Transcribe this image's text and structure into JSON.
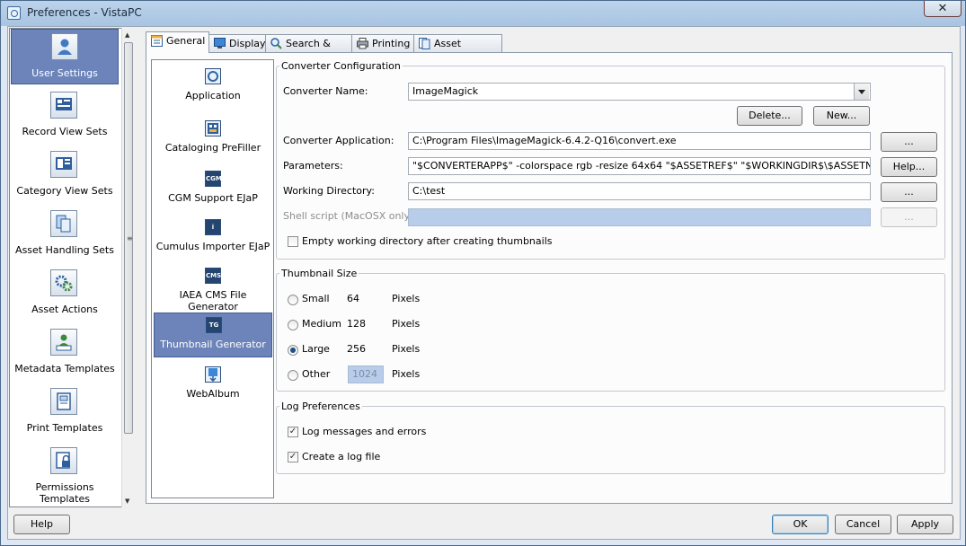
{
  "window": {
    "title": "Preferences - VistaPC",
    "close_glyph": "✕"
  },
  "sidebar": {
    "items": [
      {
        "label": "User Settings",
        "icon": "user-icon",
        "selected": true
      },
      {
        "label": "Record View Sets",
        "icon": "record-view-icon"
      },
      {
        "label": "Category View Sets",
        "icon": "category-view-icon"
      },
      {
        "label": "Asset Handling Sets",
        "icon": "asset-handling-icon"
      },
      {
        "label": "Asset Actions",
        "icon": "gears-icon"
      },
      {
        "label": "Metadata Templates",
        "icon": "metadata-icon"
      },
      {
        "label": "Print Templates",
        "icon": "print-template-icon"
      },
      {
        "label": "Permissions Templates",
        "icon": "lock-icon"
      }
    ]
  },
  "tabs": [
    {
      "label": "General",
      "icon": "general-icon",
      "active": true
    },
    {
      "label": "Display",
      "icon": "monitor-icon"
    },
    {
      "label": "Search & Sort",
      "icon": "magnifier-icon"
    },
    {
      "label": "Printing",
      "icon": "printer-icon"
    },
    {
      "label": "Asset Handling",
      "icon": "asset-icon"
    }
  ],
  "plugins": [
    {
      "label": "Application",
      "icon": "application-icon"
    },
    {
      "label": "Cataloging PreFiller",
      "icon": "prefiller-icon"
    },
    {
      "label": "CGM Support EJaP",
      "icon": "cgm-icon",
      "badge": "CGM"
    },
    {
      "label": "Cumulus Importer EJaP",
      "icon": "importer-icon",
      "badge": "i"
    },
    {
      "label": "IAEA CMS File Generator",
      "icon": "cms-icon",
      "badge": "CMS"
    },
    {
      "label": "Thumbnail Generator",
      "icon": "tg-icon",
      "badge": "TG",
      "selected": true
    },
    {
      "label": "WebAlbum",
      "icon": "webalbum-icon"
    }
  ],
  "converter": {
    "legend": "Converter Configuration",
    "name_label": "Converter Name:",
    "name_value": "ImageMagick",
    "delete_label": "Delete...",
    "new_label": "New...",
    "app_label": "Converter Application:",
    "app_value": "C:\\Program Files\\ImageMagick-6.4.2-Q16\\convert.exe",
    "browse_label": "...",
    "params_label": "Parameters:",
    "params_value": "\"$CONVERTERAPP$\" -colorspace rgb -resize 64x64  \"$ASSETREF$\" \"$WORKINGDIR$\\$ASSETNAME.jpg$\"",
    "help_label": "Help...",
    "workdir_label": "Working Directory:",
    "workdir_value": "C:\\test",
    "shell_label": "Shell script (MacOSX only):",
    "shell_value": "",
    "empty_dir_label": "Empty working directory after creating thumbnails",
    "empty_dir_checked": false
  },
  "thumbnail": {
    "legend": "Thumbnail Size",
    "options": [
      {
        "label": "Small",
        "value": "64",
        "unit": "Pixels"
      },
      {
        "label": "Medium",
        "value": "128",
        "unit": "Pixels"
      },
      {
        "label": "Large",
        "value": "256",
        "unit": "Pixels",
        "selected": true
      },
      {
        "label": "Other",
        "value": "1024",
        "unit": "Pixels"
      }
    ]
  },
  "log": {
    "legend": "Log Preferences",
    "messages_label": "Log messages and errors",
    "messages_checked": true,
    "file_label": "Create a log file",
    "file_checked": true,
    "check_glyph": "✓"
  },
  "footer": {
    "help": "Help",
    "ok": "OK",
    "cancel": "Cancel",
    "apply": "Apply"
  },
  "colors": {
    "selection": "#6c84ba",
    "disabled_field": "#b7cde9"
  }
}
